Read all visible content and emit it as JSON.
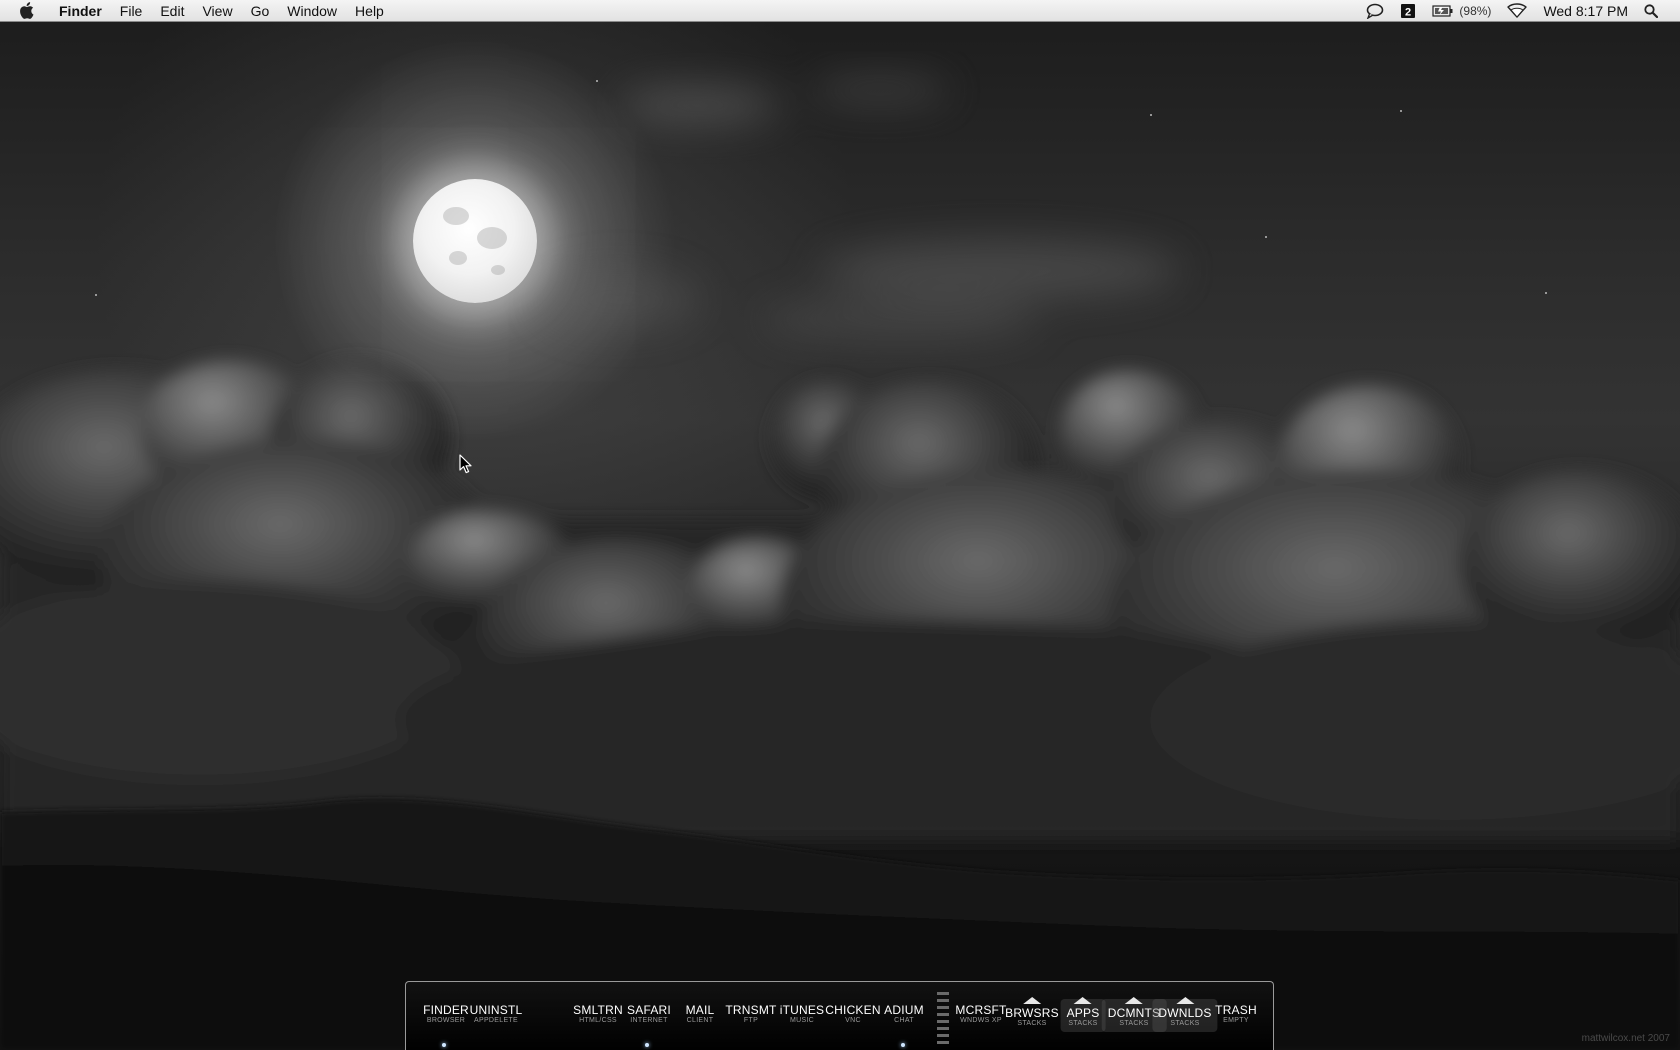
{
  "menubar": {
    "app_name": "Finder",
    "menus": [
      "File",
      "Edit",
      "View",
      "Go",
      "Window",
      "Help"
    ],
    "battery_percent": "(98%)",
    "clock": "Wed 8:17 PM"
  },
  "dock": {
    "items": [
      {
        "label": "FINDER",
        "sub": "BROWSER",
        "running": true
      },
      {
        "label": "UNINSTL",
        "sub": "APPDELETE",
        "running": false
      },
      {
        "label": "SMLTRN",
        "sub": "HTML/CSS",
        "running": false
      },
      {
        "label": "SAFARI",
        "sub": "INTERNET",
        "running": true
      },
      {
        "label": "MAIL",
        "sub": "CLIENT",
        "running": false
      },
      {
        "label": "TRNSMT",
        "sub": "FTP",
        "running": false
      },
      {
        "label": "iTUNES",
        "sub": "MUSIC",
        "running": false
      },
      {
        "label": "CHICKEN",
        "sub": "VNC",
        "running": false
      },
      {
        "label": "ADIUM",
        "sub": "CHAT",
        "running": true
      },
      {
        "label": "MCRSFT",
        "sub": "WNDWS XP",
        "running": false
      },
      {
        "label": "BRWSRS",
        "sub": "STACKS",
        "running": false
      },
      {
        "label": "APPS",
        "sub": "STACKS",
        "running": false
      },
      {
        "label": "DCMNTS",
        "sub": "STACKS",
        "running": false
      },
      {
        "label": "DWNLDS",
        "sub": "STACKS",
        "running": false
      },
      {
        "label": "TRASH",
        "sub": "EMPTY",
        "running": false
      }
    ]
  },
  "wallpaper_credit": "mattwilcox.net 2007",
  "colors": {
    "menubar_bg": "#e6e6e6",
    "dock_bg": "#0a0a0a",
    "running_indicator": "#cfe6ff"
  }
}
